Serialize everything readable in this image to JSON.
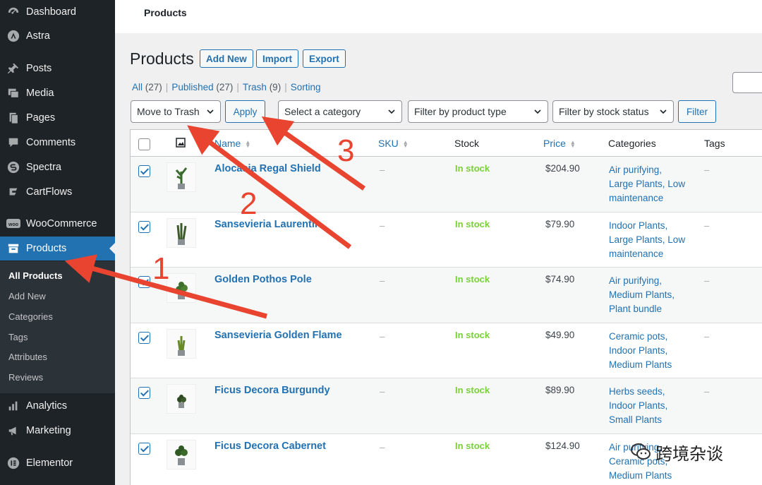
{
  "sidebar": {
    "items": [
      {
        "label": "Dashboard",
        "icon": "dashboard-icon"
      },
      {
        "label": "Astra",
        "icon": "astra-icon"
      },
      {
        "label": "Posts",
        "icon": "pin-icon"
      },
      {
        "label": "Media",
        "icon": "media-icon"
      },
      {
        "label": "Pages",
        "icon": "page-icon"
      },
      {
        "label": "Comments",
        "icon": "comment-icon"
      },
      {
        "label": "Spectra",
        "icon": "spectra-icon"
      },
      {
        "label": "CartFlows",
        "icon": "cartflows-icon"
      },
      {
        "label": "WooCommerce",
        "icon": "woo-icon"
      },
      {
        "label": "Products",
        "icon": "archive-icon"
      },
      {
        "label": "Analytics",
        "icon": "chart-icon"
      },
      {
        "label": "Marketing",
        "icon": "megaphone-icon"
      },
      {
        "label": "Elementor",
        "icon": "elementor-icon"
      }
    ],
    "submenu": [
      "All Products",
      "Add New",
      "Categories",
      "Tags",
      "Attributes",
      "Reviews"
    ]
  },
  "topbar": {
    "title": "Products"
  },
  "heading": {
    "title": "Products",
    "buttons": [
      "Add New",
      "Import",
      "Export"
    ]
  },
  "filters": {
    "all": "All",
    "all_count": "(27)",
    "published": "Published",
    "published_count": "(27)",
    "trash": "Trash",
    "trash_count": "(9)",
    "sorting": "Sorting"
  },
  "tablenav": {
    "bulk_action": "Move to Trash",
    "apply": "Apply",
    "category": "Select a category",
    "product_type": "Filter by product type",
    "stock_status": "Filter by stock status",
    "filter": "Filter"
  },
  "table": {
    "headers": {
      "name": "Name",
      "sku": "SKU",
      "stock": "Stock",
      "price": "Price",
      "categories": "Categories",
      "tags": "Tags"
    },
    "rows": [
      {
        "name": "Alocasia Regal Shield",
        "sku": "–",
        "stock": "In stock",
        "price": "$204.90",
        "cats": [
          "Air purifying,",
          "Large Plants, Low",
          "maintenance"
        ],
        "tags": "–",
        "checked": true
      },
      {
        "name": "Sansevieria Laurentii",
        "sku": "–",
        "stock": "In stock",
        "price": "$79.90",
        "cats": [
          "Indoor Plants,",
          "Large Plants, Low",
          "maintenance"
        ],
        "tags": "–",
        "checked": true
      },
      {
        "name": "Golden Pothos Pole",
        "sku": "–",
        "stock": "In stock",
        "price": "$74.90",
        "cats": [
          "Air purifying,",
          "Medium Plants,",
          "Plant bundle"
        ],
        "tags": "–",
        "checked": true
      },
      {
        "name": "Sansevieria Golden Flame",
        "sku": "–",
        "stock": "In stock",
        "price": "$49.90",
        "cats": [
          "Ceramic pots,",
          "Indoor Plants,",
          "Medium Plants"
        ],
        "tags": "–",
        "checked": true
      },
      {
        "name": "Ficus Decora Burgundy",
        "sku": "–",
        "stock": "In stock",
        "price": "$89.90",
        "cats": [
          "Herbs seeds,",
          "Indoor Plants,",
          "Small Plants"
        ],
        "tags": "–",
        "checked": true
      },
      {
        "name": "Ficus Decora Cabernet",
        "sku": "–",
        "stock": "In stock",
        "price": "$124.90",
        "cats": [
          "Air purifying,",
          "Ceramic pots,",
          "Medium Plants"
        ],
        "tags": "",
        "checked": true
      }
    ]
  },
  "annotations": {
    "n1": "1",
    "n2": "2",
    "n3": "3",
    "color": "#e8442f"
  },
  "watermark": {
    "text": "跨境杂谈"
  }
}
